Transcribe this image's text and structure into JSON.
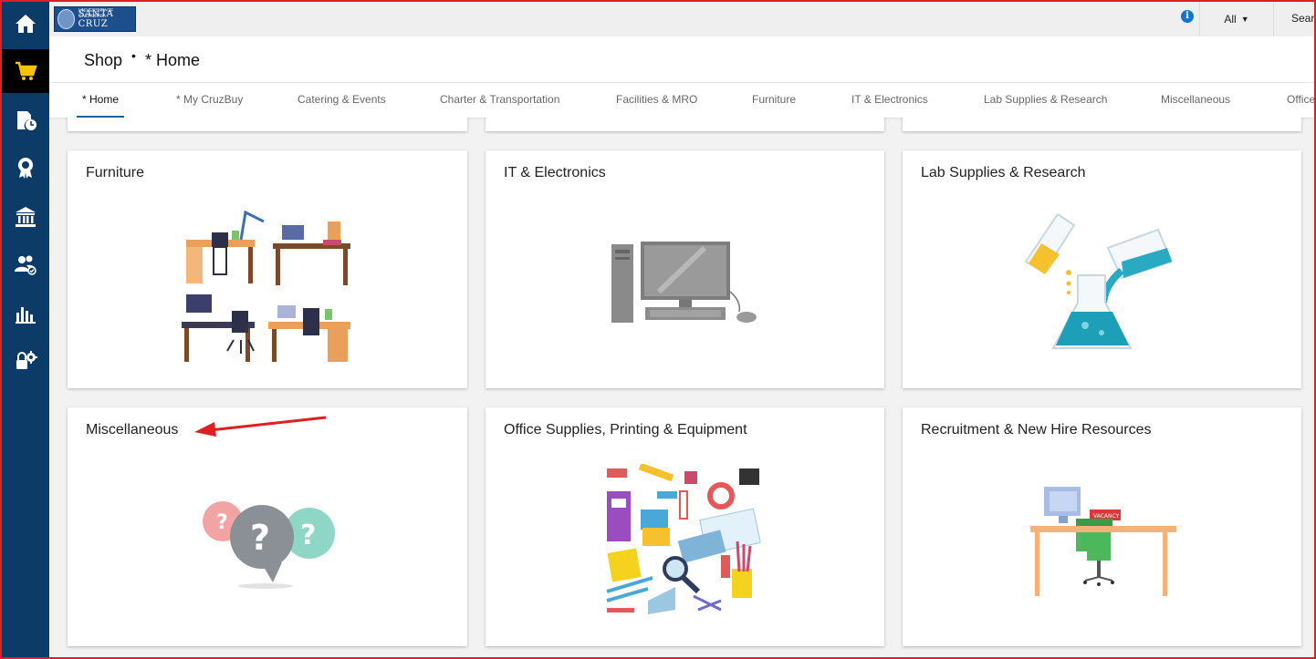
{
  "branding": {
    "logo_small": "UNIVERSITY OF CALIFORNIA",
    "logo_text": "SANTA CRUZ"
  },
  "topbar": {
    "scope_value": "All",
    "search_text": "Sear"
  },
  "header": {
    "breadcrumb_root": "Shop",
    "breadcrumb_separator": "•",
    "breadcrumb_current": "* Home"
  },
  "tabs": [
    {
      "label": "* Home",
      "active": true
    },
    {
      "label": "* My CruzBuy"
    },
    {
      "label": "Catering & Events"
    },
    {
      "label": "Charter & Transportation"
    },
    {
      "label": "Facilities & MRO"
    },
    {
      "label": "Furniture"
    },
    {
      "label": "IT & Electronics"
    },
    {
      "label": "Lab Supplies & Research"
    },
    {
      "label": "Miscellaneous"
    },
    {
      "label": "Office"
    }
  ],
  "sidebar": {
    "items": [
      {
        "icon": "home-icon"
      },
      {
        "icon": "shopping-cart-icon",
        "active": true
      },
      {
        "icon": "document-clock-icon"
      },
      {
        "icon": "award-ribbon-icon"
      },
      {
        "icon": "bank-icon"
      },
      {
        "icon": "users-check-icon"
      },
      {
        "icon": "bar-chart-icon"
      },
      {
        "icon": "lock-gear-icon"
      }
    ]
  },
  "cards": [
    {
      "title": "Furniture",
      "illustration": "desks-illustration"
    },
    {
      "title": "IT & Electronics",
      "illustration": "computer-illustration"
    },
    {
      "title": "Lab Supplies & Research",
      "illustration": "chemistry-flask-illustration"
    },
    {
      "title": "Miscellaneous",
      "illustration": "question-bubbles-illustration"
    },
    {
      "title": "Office Supplies, Printing & Equipment",
      "illustration": "office-supplies-illustration"
    },
    {
      "title": "Recruitment & New Hire Resources",
      "illustration": "vacancy-desk-illustration"
    }
  ],
  "annotation": {
    "sign_text": "VACANCY"
  },
  "colors": {
    "sidebar": "#0b3b66",
    "active_item": "#000000",
    "cart_accent": "#f5c400",
    "tab_underline": "#1f5fa5",
    "annotation_red": "#e02020"
  }
}
